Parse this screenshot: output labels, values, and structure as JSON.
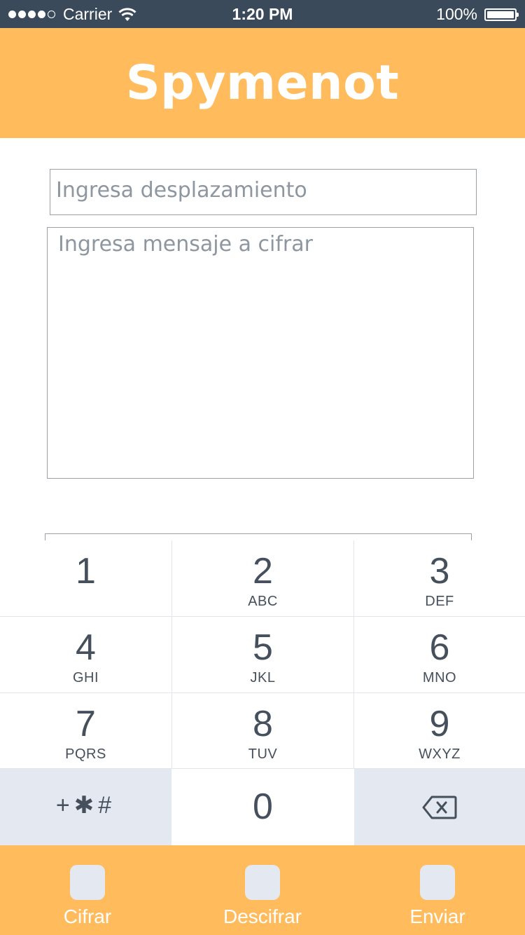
{
  "status_bar": {
    "carrier": "Carrier",
    "time": "1:20 PM",
    "battery": "100%",
    "signal_bars_filled": 4,
    "signal_bars_total": 5
  },
  "header": {
    "title": "Spymenot"
  },
  "form": {
    "shift_placeholder": "Ingresa desplazamiento",
    "message_placeholder": "Ingresa mensaje a cifrar"
  },
  "keypad": {
    "keys": [
      {
        "digit": "1",
        "letters": ""
      },
      {
        "digit": "2",
        "letters": "ABC"
      },
      {
        "digit": "3",
        "letters": "DEF"
      },
      {
        "digit": "4",
        "letters": "GHI"
      },
      {
        "digit": "5",
        "letters": "JKL"
      },
      {
        "digit": "6",
        "letters": "MNO"
      },
      {
        "digit": "7",
        "letters": "PQRS"
      },
      {
        "digit": "8",
        "letters": "TUV"
      },
      {
        "digit": "9",
        "letters": "WXYZ"
      },
      {
        "digit": "0",
        "letters": ""
      }
    ],
    "symbols_label": "+✱#"
  },
  "tabs": [
    {
      "label": "Cifrar"
    },
    {
      "label": "Descifrar"
    },
    {
      "label": "Enviar"
    }
  ],
  "colors": {
    "accent": "#ffbb5c",
    "status_bar": "#3b4a5a",
    "key_text": "#46505c",
    "key_gray": "#e3e8f1"
  }
}
